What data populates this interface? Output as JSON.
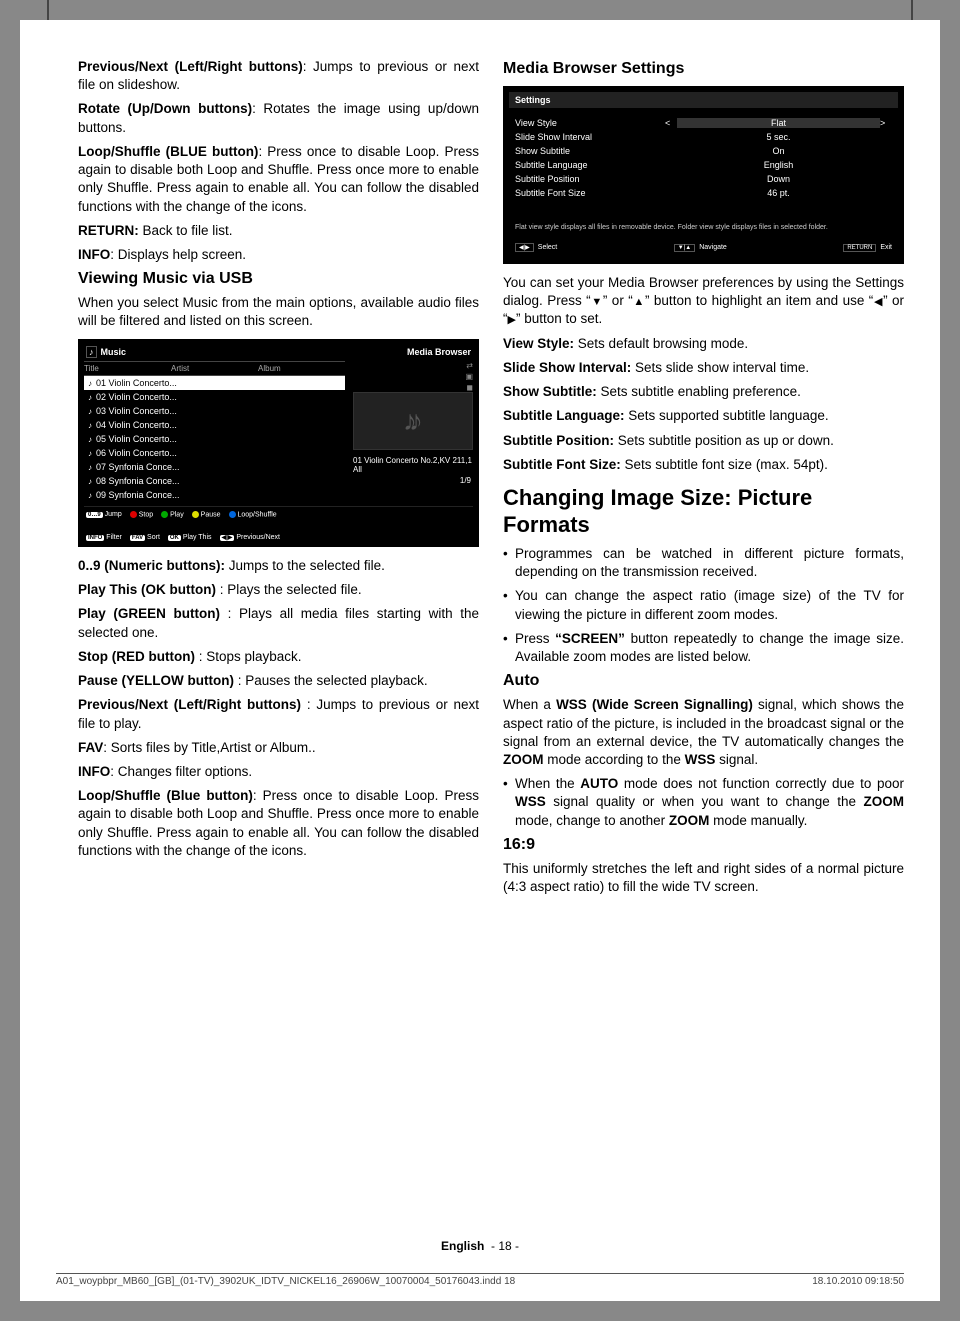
{
  "left": {
    "p1": {
      "b": "Previous/Next (Left/Right buttons)",
      "t": ": Jumps to previous or next file on slideshow."
    },
    "p2": {
      "b": "Rotate (Up/Down buttons)",
      "t": ": Rotates the image using up/down buttons."
    },
    "p3": {
      "b": "Loop/Shuffle (BLUE button)",
      "t": ": Press once to disable Loop. Press again to disable both Loop and Shuffle. Press once more to enable only Shuffle. Press again to enable all. You can follow the disabled functions with the change of the icons."
    },
    "p4": {
      "b": "RETURN: ",
      "t": "Back to file list."
    },
    "p5": {
      "b": "INFO",
      "t": ": Displays help screen."
    },
    "h1": "Viewing Music via USB",
    "p6": "When you select Music from the main options, available audio files will be filtered and listed on this screen.",
    "music_ss": {
      "title_left": "Music",
      "title_right": "Media Browser",
      "hdr": [
        "Title",
        "Artist",
        "Album"
      ],
      "items": [
        "01 Violin Concerto...",
        "02 Violin Concerto...",
        "03 Violin Concerto...",
        "04 Violin Concerto...",
        "05 Violin Concerto...",
        "06 Violin Concerto...",
        "07 Synfonia Conce...",
        "08 Synfonia Conce...",
        "09 Synfonia Conce..."
      ],
      "now": "01 Violin Concerto No.2,KV 211,1 All",
      "count": "1/9",
      "ctrls": {
        "jump": "Jump",
        "stop": "Stop",
        "play": "Play",
        "pause": "Pause",
        "loop": "Loop/Shuffle",
        "filter": "Filter",
        "sort": "Sort",
        "playthis": "Play This",
        "prevnext": "Previous/Next"
      }
    },
    "p7": {
      "b": "0..9 (Numeric buttons):",
      "t": " Jumps to the selected file."
    },
    "p8": {
      "b": "Play This (OK button)",
      "t": " : Plays the selected file."
    },
    "p9": {
      "b": "Play (GREEN button)",
      "t": " : Plays all media files starting with the selected one."
    },
    "p10": {
      "b": "Stop (RED button)",
      "t": " : Stops playback."
    },
    "p11": {
      "b": "Pause (YELLOW button)",
      "t": " : Pauses the selected playback."
    },
    "p12": {
      "b": "Previous/Next (Left/Right buttons)",
      "t": " : Jumps to previous or next file to play."
    },
    "p13": {
      "b": "FAV",
      "t": ": Sorts files by Title,Artist or Album.."
    },
    "p14": {
      "b": "INFO",
      "t": ": Changes filter options."
    },
    "p15": {
      "b": "Loop/Shuffle (Blue button)",
      "t": ": Press once to disable Loop. Press again to disable both Loop and Shuffle. Press once more to enable only Shuffle. Press again to enable all. You can follow the disabled functions with the change of the icons."
    }
  },
  "right": {
    "h1": "Media Browser Settings",
    "settings_ss": {
      "title": "Settings",
      "rows": [
        {
          "lab": "View Style",
          "val": "Flat",
          "sel": true
        },
        {
          "lab": "Slide Show Interval",
          "val": "5 sec."
        },
        {
          "lab": "Show Subtitle",
          "val": "On"
        },
        {
          "lab": "Subtitle Language",
          "val": "English"
        },
        {
          "lab": "Subtitle Position",
          "val": "Down"
        },
        {
          "lab": "Subtitle Font Size",
          "val": "46 pt."
        }
      ],
      "desc": "Flat view style displays all files in removable device. Folder view style displays files in selected folder.",
      "foot": {
        "select": "Select",
        "nav": "Navigate",
        "exit": "Exit"
      }
    },
    "p1a": "You can set your Media Browser preferences by using the Settings dialog. Press “",
    "p1b": "” or “",
    "p1c": "” button to highlight an item and use “",
    "p1d": "” or “",
    "p1e": "” button to set.",
    "p2": {
      "b": "View Style:",
      "t": " Sets default browsing mode."
    },
    "p3": {
      "b": "Slide Show Interval:",
      "t": " Sets slide show interval time."
    },
    "p4": {
      "b": "Show Subtitle:",
      "t": " Sets subtitle enabling preference."
    },
    "p5": {
      "b": "Subtitle Language:",
      "t": " Sets supported subtitle language."
    },
    "p6": {
      "b": "Subtitle Position:",
      "t": " Sets subtitle position as up or down."
    },
    "p7": {
      "b": "Subtitle Font Size:",
      "t": " Sets subtitle font size (max. 54pt)."
    },
    "h2": "Changing Image Size: Picture Formats",
    "b1": "Programmes can be watched in different picture formats, depending on the transmission received.",
    "b2": "You can change the aspect ratio (image size) of the TV for viewing the picture in different zoom modes.",
    "b3a": "Press ",
    "b3b": "“SCREEN”",
    "b3c": " button repeatedly to change the image size. Available zoom modes are listed below.",
    "h3": "Auto",
    "p8a": "When a ",
    "p8b": "WSS (Wide Screen Signalling)",
    "p8c": " signal, which shows the aspect ratio of the picture, is included in the broadcast signal or the signal from an external device, the TV automatically changes the ",
    "p8d": "ZOOM",
    "p8e": " mode according to the ",
    "p8f": "WSS",
    "p8g": " signal.",
    "b4a": "When the ",
    "b4b": "AUTO",
    "b4c": " mode does not function correctly due to poor ",
    "b4d": "WSS",
    "b4e": " signal quality or when you want to change the ",
    "b4f": "ZOOM",
    "b4g": " mode, change to another ",
    "b4h": "ZOOM",
    "b4i": " mode manually.",
    "h4": "16:9",
    "p9": "This uniformly stretches the left and right sides of a normal picture (4:3 aspect ratio) to fill the wide TV screen."
  },
  "footer": {
    "lang": "English",
    "page": "- 18 -"
  },
  "footline": {
    "l": "A01_woypbpr_MB60_[GB]_(01-TV)_3902UK_IDTV_NICKEL16_26906W_10070004_50176043.indd   18",
    "r": "18.10.2010   09:18:50"
  }
}
